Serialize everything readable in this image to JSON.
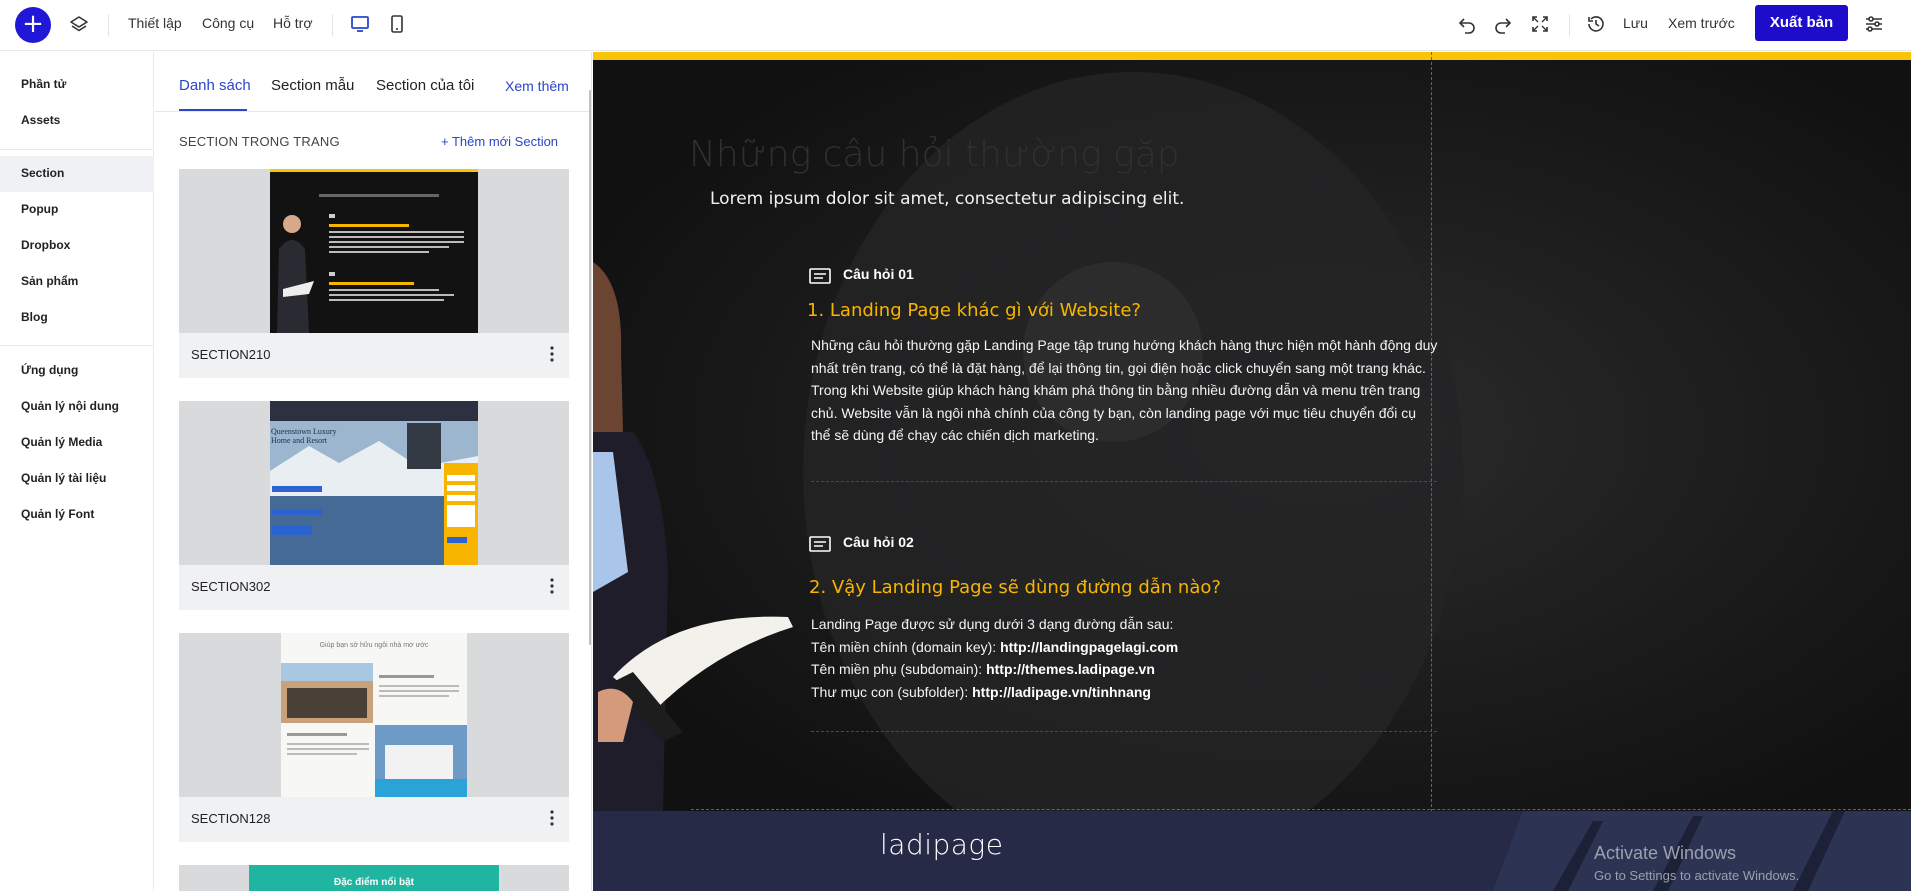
{
  "topbar": {
    "add_icon": "plus-icon",
    "menu": [
      "Thiết lập",
      "Công cụ",
      "Hỗ trợ"
    ],
    "save_label": "Lưu",
    "preview_label": "Xem trước",
    "publish_label": "Xuất bản",
    "accent": "#1e0ccb"
  },
  "sidebar": {
    "group1": [
      "Phần tử",
      "Assets"
    ],
    "group2": [
      "Section",
      "Popup",
      "Dropbox",
      "Sản phẩm",
      "Blog"
    ],
    "group3": [
      "Ứng dụng",
      "Quản lý nội dung",
      "Quản lý Media",
      "Quản lý tài liệu",
      "Quản lý Font"
    ],
    "active": "Section"
  },
  "panel": {
    "tabs": [
      "Danh sách",
      "Section mẫu",
      "Section của tôi"
    ],
    "more_link": "Xem thêm",
    "heading": "SECTION TRONG TRANG",
    "add_label": "Thêm mới Section",
    "cards": [
      "SECTION210",
      "SECTION302",
      "SECTION128"
    ],
    "fourth_card_text": "Đặc điểm nổi bật",
    "thumb302_title": "Queenstown Luxury Home and Resort",
    "thumb128_title": "Giúp bạn sở hữu ngôi nhà mơ ước"
  },
  "canvas": {
    "title": "Những câu hỏi thường gặp",
    "subtitle": "Lorem ipsum dolor sit amet, consectetur adipiscing elit.",
    "q1_tag": "Câu hỏi 01",
    "q1_title": "1. Landing Page khác gì với Website?",
    "q1_lines": [
      "Những câu hỏi thường gặp Landing Page tập trung hướng khách hàng thực hiện một hành động duy",
      "nhất trên trang, có thể là đặt hàng, để lại thông tin, gọi điện hoặc click chuyển sang một trang khác.",
      "Trong khi Website giúp khách hàng khám phá thông tin bằng nhiều đường dẫn và menu trên trang",
      "chủ. Website vẫn là ngôi nhà chính của công ty bạn, còn landing page với mục tiêu chuyển đổi cụ",
      "thể sẽ dùng để chạy các chiến dịch marketing."
    ],
    "q2_tag": "Câu hỏi 02",
    "q2_title": "2. Vậy Landing Page sẽ dùng đường dẫn nào?",
    "q2_intro": "Landing Page được sử dụng dưới 3 dạng đường dẫn sau:",
    "q2_rows": [
      {
        "label": "Tên miền chính (domain key): ",
        "value": "http://landingpagelagi.com"
      },
      {
        "label": "Tên miền phụ (subdomain): ",
        "value": "http://themes.ladipage.vn"
      },
      {
        "label": "Thư mục con (subfolder): ",
        "value": "http://ladipage.vn/tinhnang"
      }
    ],
    "footer_logo": "ladipage",
    "activate_title": "Activate Windows",
    "activate_sub": "Go to Settings to activate Windows.",
    "highlight": "#f7b500",
    "bar_color": "#f7c407"
  }
}
